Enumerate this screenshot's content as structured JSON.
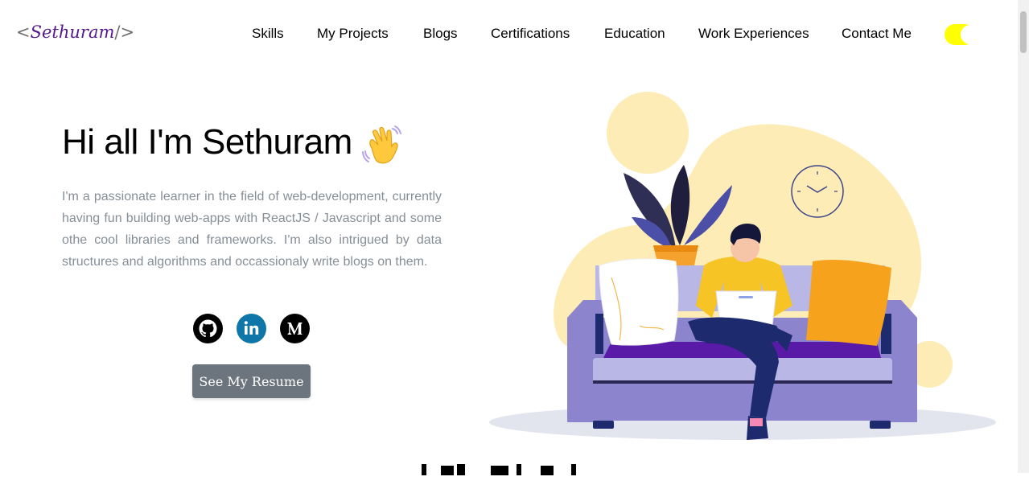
{
  "header": {
    "logo": {
      "open": "<",
      "name": "Sethuram",
      "close": "/>"
    },
    "nav": [
      {
        "label": "Skills"
      },
      {
        "label": "My Projects"
      },
      {
        "label": "Blogs"
      },
      {
        "label": "Certifications"
      },
      {
        "label": "Education"
      },
      {
        "label": "Work Experiences"
      },
      {
        "label": "Contact Me"
      }
    ],
    "theme_toggle": {
      "icon": "toggle-icon",
      "color": "#ffff00"
    }
  },
  "hero": {
    "greeting": "Hi all I'm Sethuram",
    "wave_icon": "waving-hand-icon",
    "intro": "I'm a passionate learner in the field of web-development, currently having fun building web-apps with ReactJS / Javascript and some othe cool libraries and frameworks. I'm also intrigued by data structures and algorithms and occassionaly write blogs on them.",
    "social": [
      {
        "icon": "github-icon",
        "color": "#000000"
      },
      {
        "icon": "linkedin-icon",
        "color": "#0e76a8"
      },
      {
        "icon": "medium-icon",
        "color": "#000000"
      }
    ],
    "resume_button": "See My Resume",
    "illustration": "person-on-sofa-with-laptop"
  },
  "colors": {
    "accent": "#55198b",
    "intro_text": "#868e96",
    "button_bg": "#6c757d",
    "illustration_blob": "#fdecb6"
  }
}
